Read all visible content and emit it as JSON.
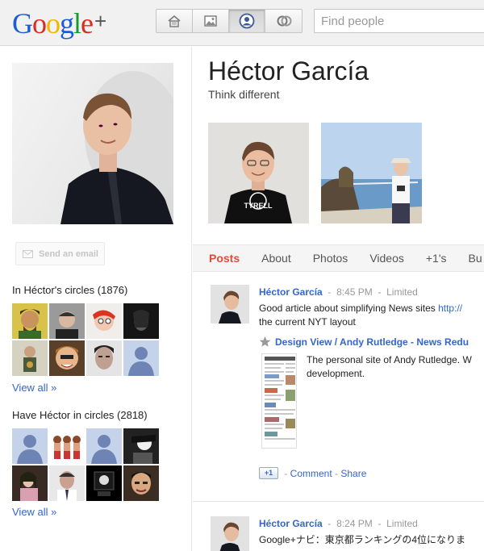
{
  "header": {
    "logo_text": "Google",
    "logo_plus": "+",
    "search_placeholder": "Find people",
    "nav_icons": [
      "home-icon",
      "photos-icon",
      "profile-icon",
      "circles-icon"
    ]
  },
  "profile": {
    "name": "Héctor García",
    "tagline": "Think different",
    "email_button": "Send an email",
    "in_circles_title": "In Héctor's circles (1876)",
    "have_in_circles_title": "Have Héctor in circles (2818)",
    "view_all": "View all »"
  },
  "tabs": [
    "Posts",
    "About",
    "Photos",
    "Videos",
    "+1's",
    "Bu"
  ],
  "posts": [
    {
      "author": "Héctor García",
      "time": "8:45 PM",
      "visibility": "Limited",
      "text_line1": "Good article about simplifying News sites ",
      "link": "http://",
      "text_line2": "the current NYT layout",
      "attachment_title": "Design View / Andy Rutledge - News Redu",
      "attachment_desc_line1": "The personal site of Andy Rutledge. W",
      "attachment_desc_line2": "development.",
      "plusone": "+1",
      "comment": "Comment",
      "share": "Share"
    },
    {
      "author": "Héctor García",
      "time": "8:24 PM",
      "visibility": "Limited",
      "text_line1": "Google+ナビ：東京都ランキングの4位になりま"
    }
  ],
  "colors": {
    "accent_red": "#dd4b39",
    "link_blue": "#3366cc",
    "meta_gray": "#999999"
  }
}
